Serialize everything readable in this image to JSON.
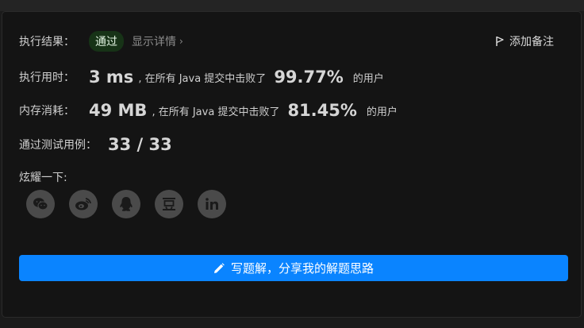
{
  "result": {
    "label": "执行结果：",
    "status": "通过",
    "detail_link": "显示详情"
  },
  "add_note_label": "添加备注",
  "runtime": {
    "label": "执行用时：",
    "value": "3 ms",
    "mid_text": ", 在所有 Java 提交中击败了",
    "percent": "99.77%",
    "suffix": "的用户"
  },
  "memory": {
    "label": "内存消耗：",
    "value": "49 MB",
    "mid_text": ", 在所有 Java 提交中击败了",
    "percent": "81.45%",
    "suffix": "的用户"
  },
  "testcases": {
    "label": "通过测试用例：",
    "value": "33 / 33"
  },
  "share": {
    "label": "炫耀一下:",
    "icons": [
      "wechat-icon",
      "weibo-icon",
      "qq-icon",
      "douban-icon",
      "linkedin-icon"
    ]
  },
  "write_solution_label": "写题解，分享我的解题思路",
  "colors": {
    "accent": "#0a84ff",
    "pass_bg": "#173317",
    "card_bg": "#141414"
  }
}
